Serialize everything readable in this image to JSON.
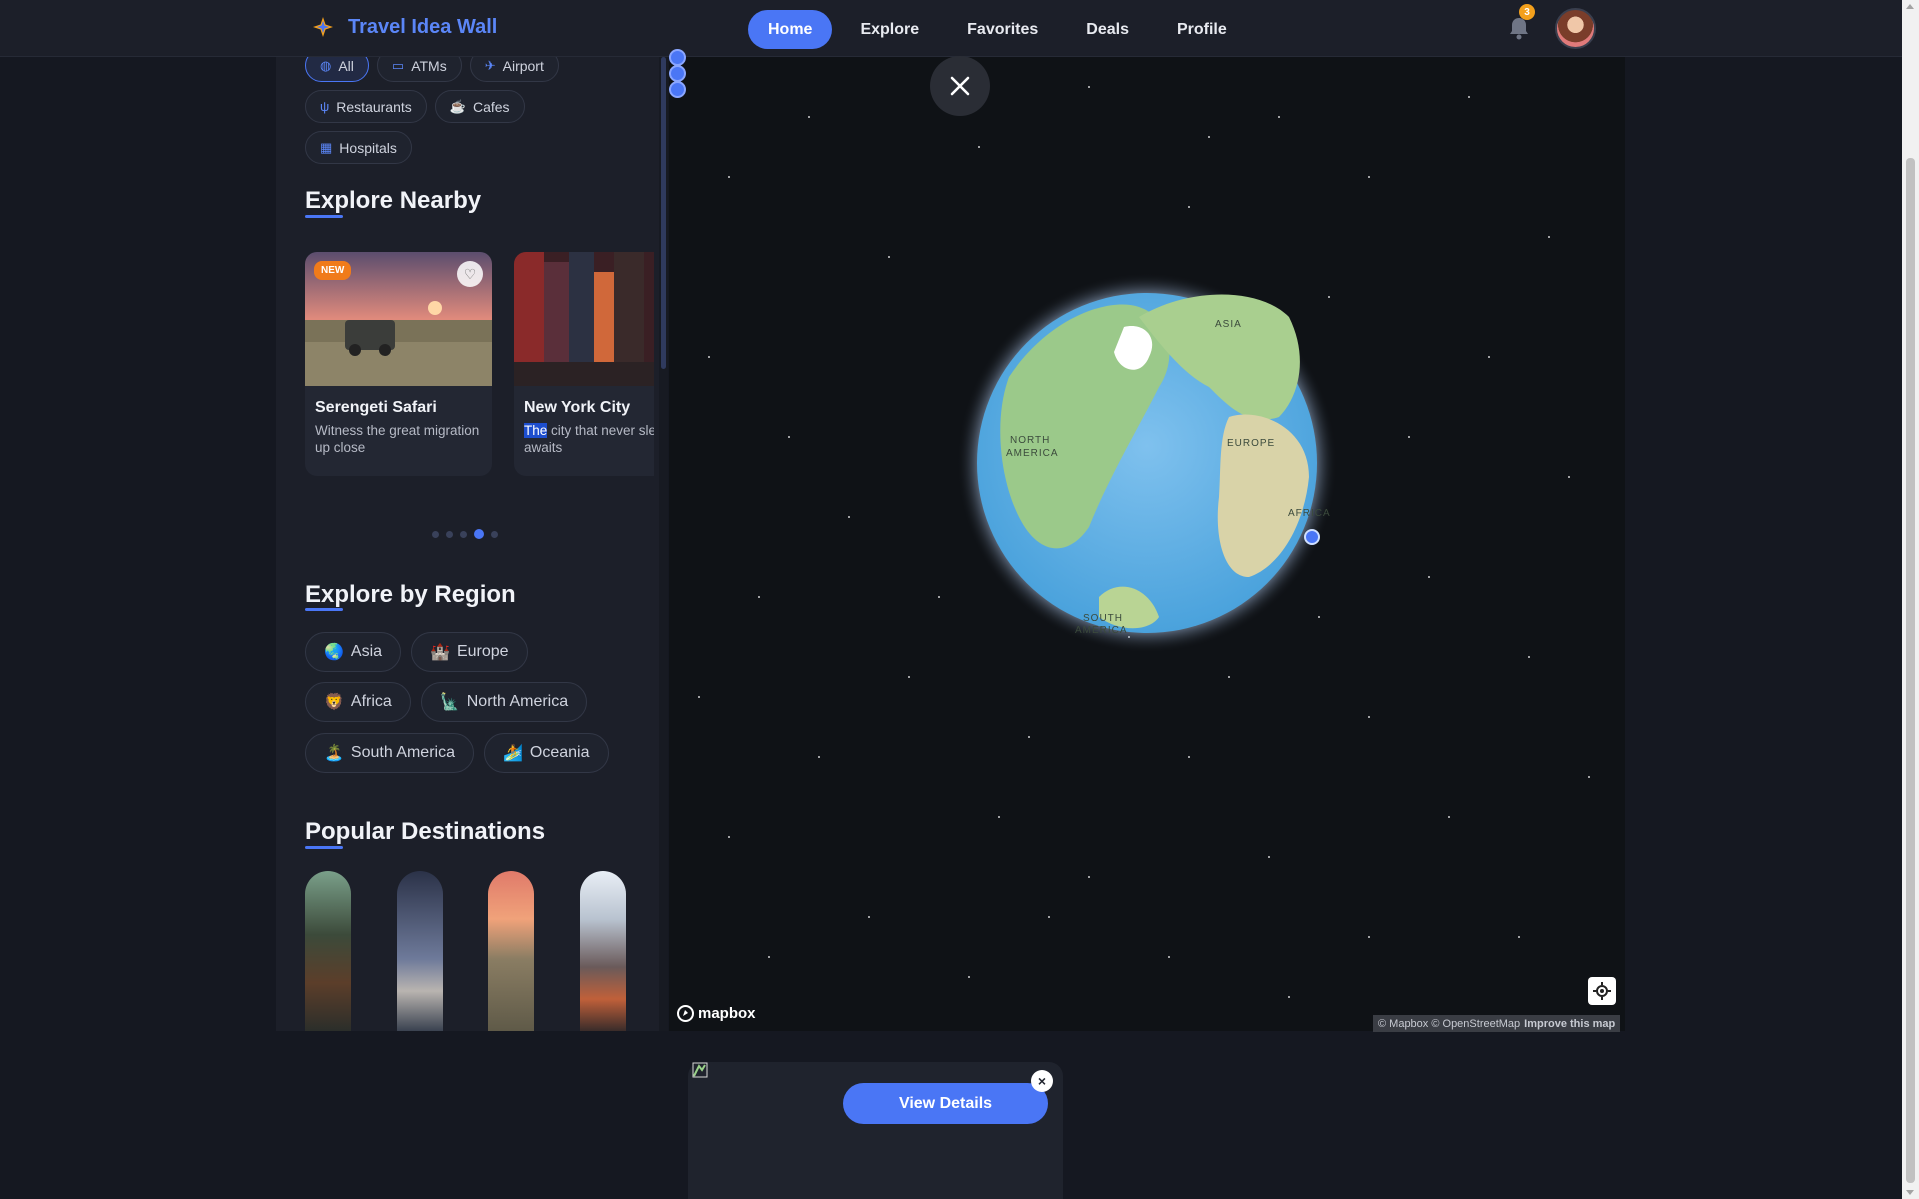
{
  "header": {
    "brand": "Travel Idea Wall",
    "nav": [
      "Home",
      "Explore",
      "Favorites",
      "Deals",
      "Profile"
    ],
    "active_nav": "Home",
    "notifications_count": "3"
  },
  "sidebar": {
    "filters": [
      "All",
      "ATMs",
      "Airport",
      "Restaurants",
      "Cafes",
      "Hospitals"
    ],
    "active_filter": "All",
    "explore_nearby": {
      "title": "Explore Nearby",
      "cards": [
        {
          "badge": "NEW",
          "title": "Serengeti Safari",
          "description": "Witness the great migration up close"
        },
        {
          "title": "New York City",
          "description_highlight": "The",
          "description_rest": " city that never sleeps awaits"
        }
      ],
      "carousel_pages": 5,
      "carousel_active": 3
    },
    "explore_by_region": {
      "title": "Explore by Region",
      "regions": [
        {
          "emoji": "🌏",
          "label": "Asia"
        },
        {
          "emoji": "🏰",
          "label": "Europe"
        },
        {
          "emoji": "🦁",
          "label": "Africa"
        },
        {
          "emoji": "🗽",
          "label": "North America"
        },
        {
          "emoji": "🏝️",
          "label": "South America"
        },
        {
          "emoji": "🏄",
          "label": "Oceania"
        }
      ]
    },
    "popular_destinations": {
      "title": "Popular Destinations"
    }
  },
  "map": {
    "labels": {
      "asia": "ASIA",
      "north_america_1": "NORTH",
      "north_america_2": "AMERICA",
      "europe": "EUROPE",
      "africa": "AFRICA",
      "south_america_1": "SOUTH",
      "south_america_2": "AMERICA"
    },
    "logo": "mapbox",
    "attribution": "© Mapbox © OpenStreetMap",
    "improve_link": "Improve this map"
  },
  "popup": {
    "button": "View Details",
    "close": "×"
  },
  "colors": {
    "accent": "#4a76f5",
    "background": "#151821",
    "panel": "#1c1f29",
    "badge": "#f3a01c"
  }
}
